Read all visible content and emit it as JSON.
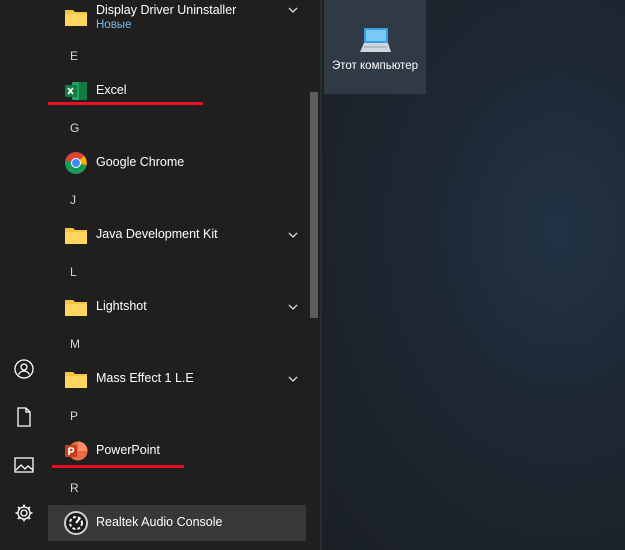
{
  "start_menu": {
    "app_list": [
      {
        "kind": "app",
        "name": "Display Driver Uninstaller",
        "badge": "Новые",
        "icon": "folder-icon",
        "expandable": true
      },
      {
        "kind": "letter",
        "label": "E"
      },
      {
        "kind": "app",
        "name": "Excel",
        "icon": "excel-icon",
        "expandable": false
      },
      {
        "kind": "letter",
        "label": "G"
      },
      {
        "kind": "app",
        "name": "Google Chrome",
        "icon": "chrome-icon",
        "expandable": false
      },
      {
        "kind": "letter",
        "label": "J"
      },
      {
        "kind": "app",
        "name": "Java Development Kit",
        "icon": "folder-icon",
        "expandable": true
      },
      {
        "kind": "letter",
        "label": "L"
      },
      {
        "kind": "app",
        "name": "Lightshot",
        "icon": "folder-icon",
        "expandable": true
      },
      {
        "kind": "letter",
        "label": "M"
      },
      {
        "kind": "app",
        "name": "Mass Effect 1 L.E",
        "icon": "folder-icon",
        "expandable": true
      },
      {
        "kind": "letter",
        "label": "P"
      },
      {
        "kind": "app",
        "name": "PowerPoint",
        "icon": "powerpoint-icon",
        "expandable": false
      },
      {
        "kind": "letter",
        "label": "R"
      },
      {
        "kind": "app",
        "name": "Realtek Audio Console",
        "icon": "realtek-audio-icon",
        "expandable": false,
        "selected": true
      }
    ],
    "rail_icons": [
      "user-icon",
      "documents-icon",
      "pictures-icon",
      "settings-icon"
    ]
  },
  "desktop": {
    "tile": {
      "label": "Этот компьютер",
      "icon": "computer-icon"
    }
  },
  "colors": {
    "annotation_underline": "#e81123",
    "new_badge": "#76b9ed",
    "menu_background": "#1f1f1f",
    "folder": "#f4c542"
  }
}
